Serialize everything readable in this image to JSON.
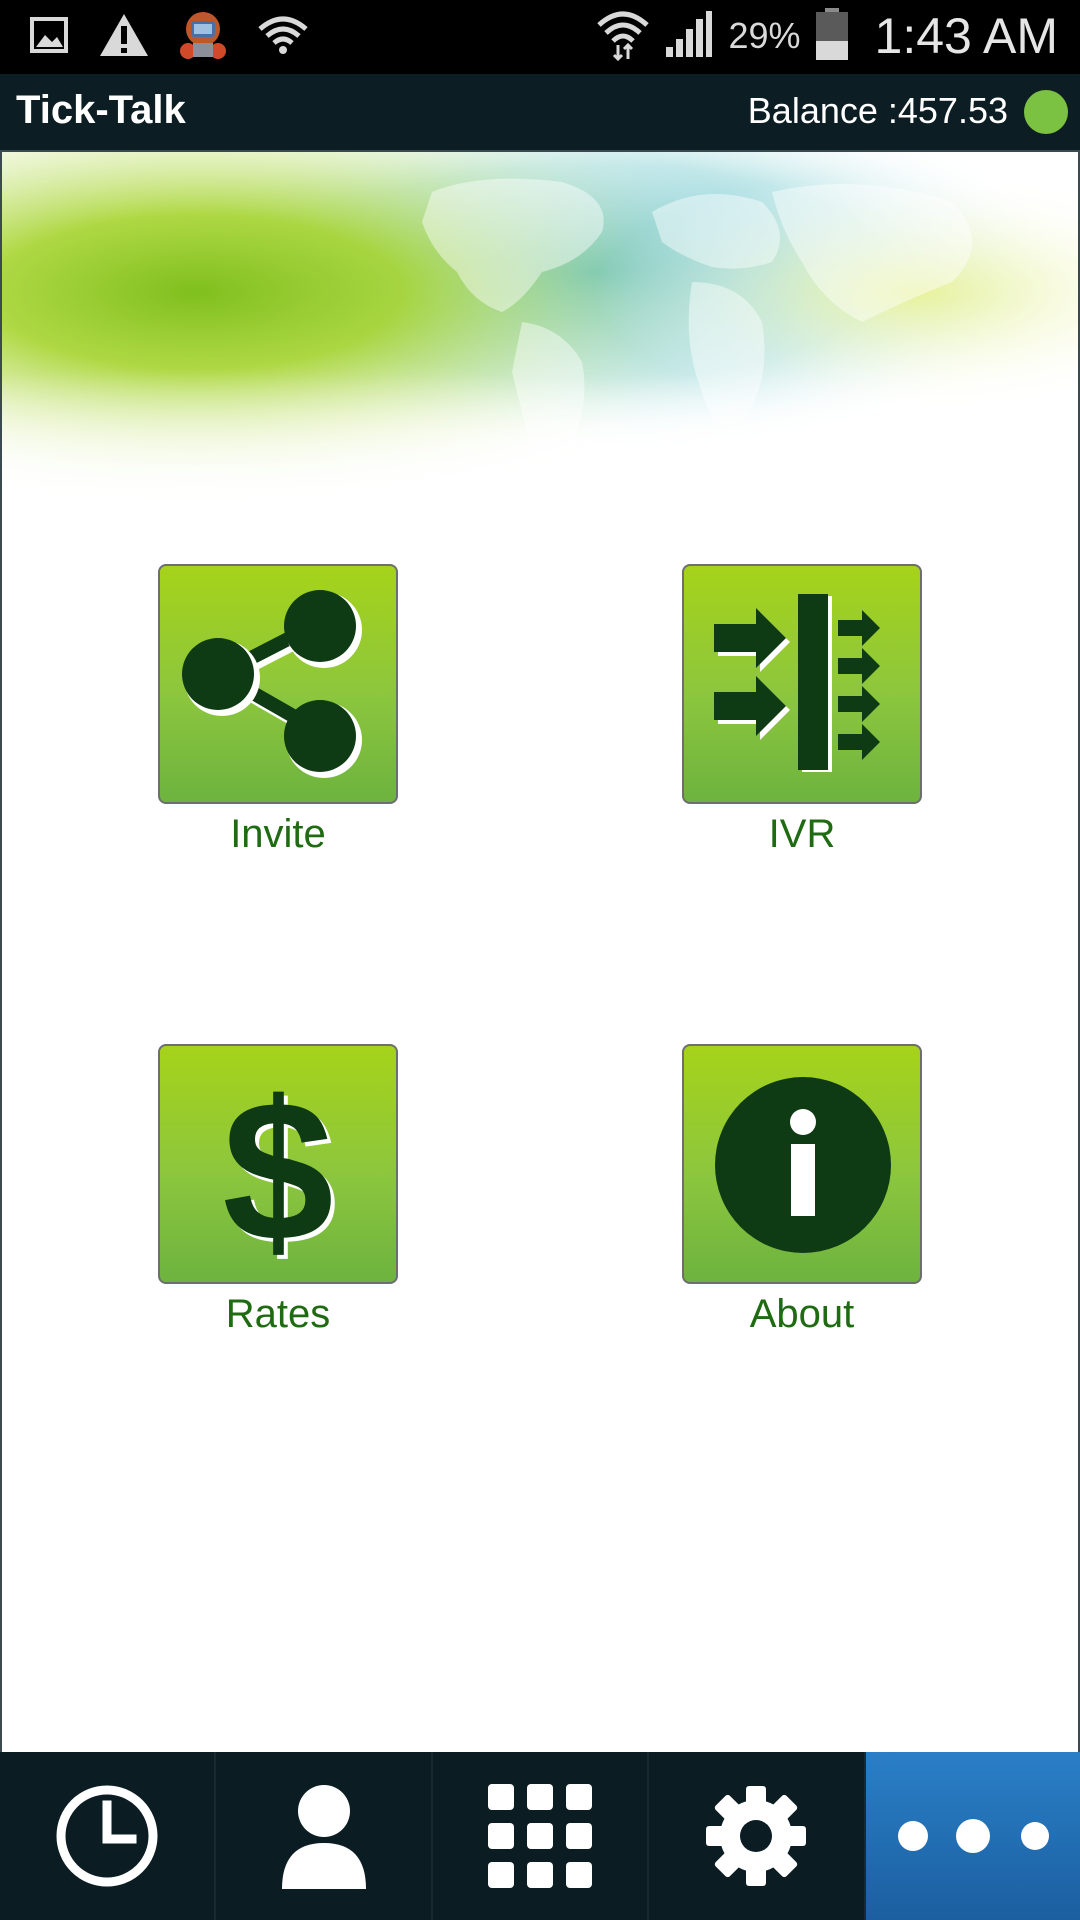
{
  "status_bar": {
    "battery_percent": "29%",
    "time": "1:43 AM",
    "icons_left": [
      "image-icon",
      "warning-icon",
      "robot-app-icon",
      "wifi-question-icon"
    ],
    "icons_right": [
      "wifi-icon",
      "signal-icon",
      "battery-icon"
    ]
  },
  "app_bar": {
    "title": "Tick-Talk",
    "balance": "Balance :457.53",
    "status_color": "#7cc242"
  },
  "tiles": [
    {
      "label": "Invite",
      "icon": "share-icon"
    },
    {
      "label": "IVR",
      "icon": "ivr-icon"
    },
    {
      "label": "Rates",
      "icon": "dollar-icon"
    },
    {
      "label": "About",
      "icon": "info-icon"
    }
  ],
  "bottom_nav": {
    "items": [
      {
        "icon": "clock-icon",
        "active": false
      },
      {
        "icon": "person-icon",
        "active": false
      },
      {
        "icon": "dialpad-icon",
        "active": false
      },
      {
        "icon": "gear-icon",
        "active": false
      },
      {
        "icon": "more-icon",
        "active": true
      }
    ]
  },
  "colors": {
    "tile_green_top": "#a6d31a",
    "tile_green_bottom": "#6db33f",
    "label_green": "#1f6b12",
    "nav_background": "#0b1c22",
    "nav_active": "#2a7fc7"
  }
}
